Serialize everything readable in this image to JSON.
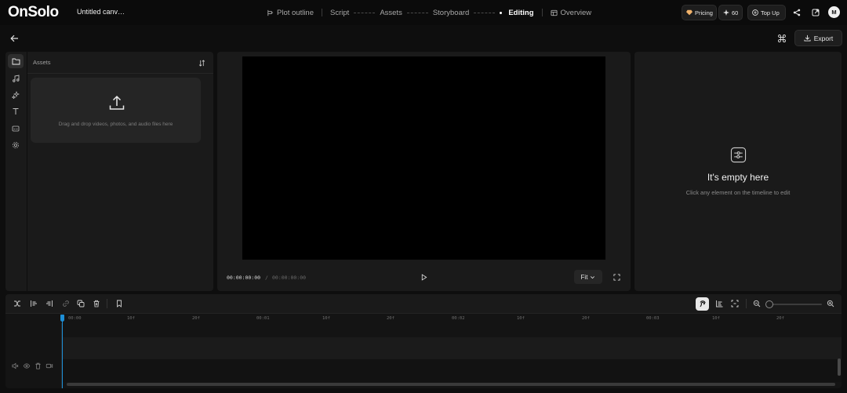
{
  "app": {
    "logo": "OnSolo",
    "doc_title": "Untitled canv…"
  },
  "nav": {
    "steps": [
      {
        "label": "Plot outline",
        "icon": "plot-outline-icon"
      },
      {
        "label": "Script"
      },
      {
        "label": "Assets"
      },
      {
        "label": "Storyboard"
      },
      {
        "label": "Editing",
        "active": true
      },
      {
        "label": "Overview",
        "icon": "overview-icon"
      }
    ],
    "pricing_label": "Pricing",
    "credits": "60",
    "topup_label": "Top Up",
    "avatar_initial": "M"
  },
  "toolbar": {
    "export_label": "Export"
  },
  "assets": {
    "title": "Assets",
    "drop_text": "Drag and drop videos, photos, and audio files here"
  },
  "preview": {
    "current_time": "00:00:00:00",
    "separator": "/",
    "total_time": "00:00:00:00",
    "fit_label": "Fit"
  },
  "properties": {
    "empty_title": "It's empty here",
    "empty_subtitle": "Click any element on the timeline to edit"
  },
  "timeline": {
    "ticks": [
      "00:00",
      "10f",
      "20f",
      "00:01",
      "10f",
      "20f",
      "00:02",
      "10f",
      "20f",
      "00:03",
      "10f",
      "20f"
    ]
  },
  "colors": {
    "background": "#0e0e0e",
    "panel": "#1a1a1a",
    "playhead": "#1e8fd6",
    "pricing_gem": "#f2b36b"
  }
}
